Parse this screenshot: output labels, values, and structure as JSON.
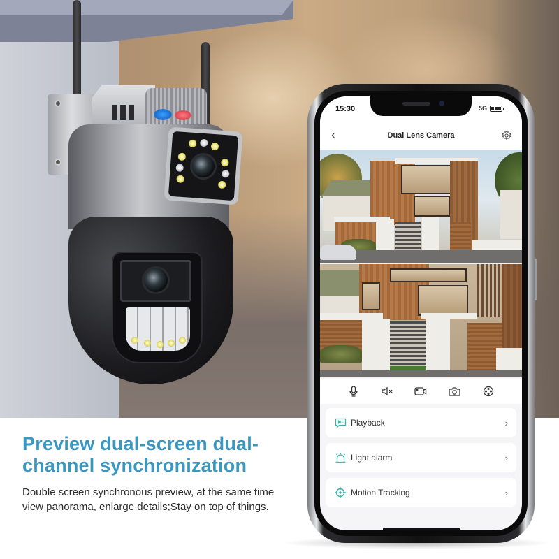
{
  "scene": {
    "description": "Dual-lens PTZ security camera mounted on wall beside a smartphone showing its app"
  },
  "marketing": {
    "headline_line1": "Preview dual-screen dual-",
    "headline_line2": "channel synchronization",
    "description": "Double screen synchronous preview, at the same time view panorama, enlarge details;Stay on top of things.",
    "headline_color": "#3a97bf"
  },
  "phone": {
    "status_bar": {
      "time": "15:30",
      "network": "5G",
      "battery_icon": "battery-full-icon"
    },
    "app_bar": {
      "back_icon": "chevron-left-icon",
      "back_glyph": "‹",
      "title": "Dual Lens Camera",
      "settings_icon": "gear-icon"
    },
    "feeds": [
      {
        "name": "lens-1-feed",
        "subject": "Modern wood-clad house, wide view with car"
      },
      {
        "name": "lens-2-feed",
        "subject": "Modern wood-clad house, zoomed detail view"
      }
    ],
    "controls": [
      {
        "name": "microphone",
        "icon": "microphone-icon"
      },
      {
        "name": "mute",
        "icon": "speaker-mute-icon"
      },
      {
        "name": "record",
        "icon": "video-record-icon"
      },
      {
        "name": "snapshot",
        "icon": "camera-icon"
      },
      {
        "name": "ptz",
        "icon": "ptz-control-icon"
      }
    ],
    "menu": [
      {
        "label": "Playback",
        "icon": "playback-icon",
        "chevron": "›"
      },
      {
        "label": "Light alarm",
        "icon": "alarm-light-icon",
        "chevron": "›"
      },
      {
        "label": "Motion Tracking",
        "icon": "crosshair-icon",
        "chevron": "›"
      }
    ],
    "accent_color": "#3bb5a6"
  }
}
